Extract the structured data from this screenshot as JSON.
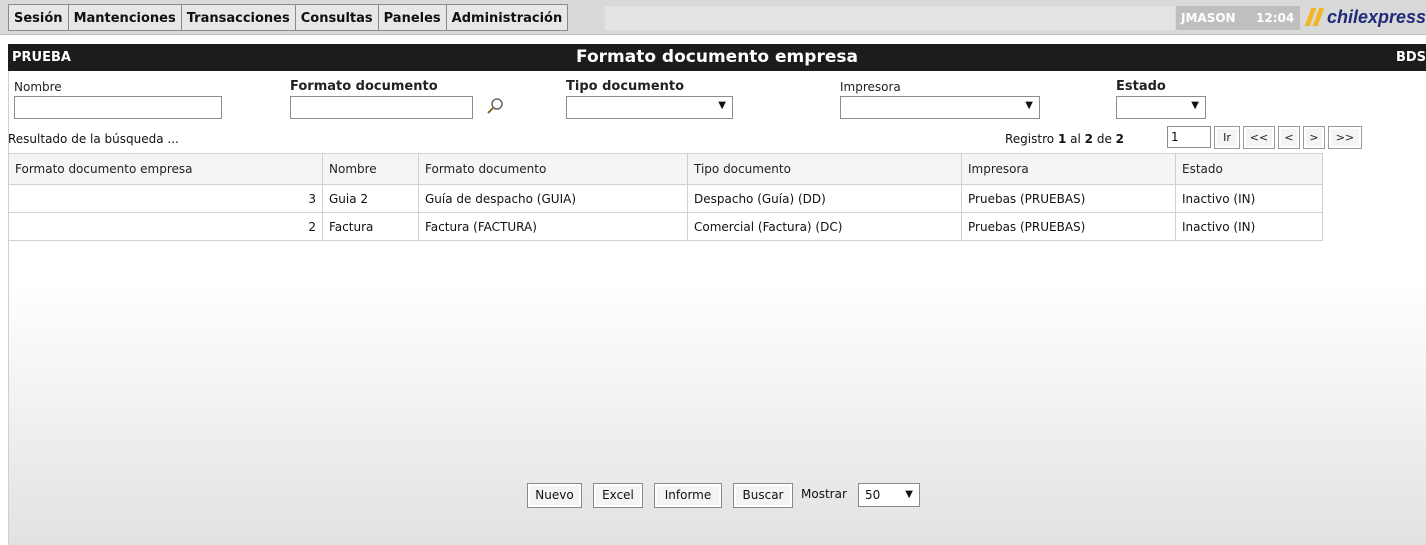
{
  "menu": {
    "items": [
      "Sesión",
      "Mantenciones",
      "Transacciones",
      "Consultas",
      "Paneles",
      "Administración"
    ],
    "user": "JMASON",
    "time": "12:04",
    "logo_text": "chilexpress"
  },
  "titlebar": {
    "left": "PRUEBA",
    "title": "Formato documento empresa",
    "right": "BDS"
  },
  "filters": {
    "nombre_label": "Nombre",
    "nombre_value": "",
    "formato_label": "Formato documento",
    "formato_value": "",
    "tipo_label": "Tipo documento",
    "tipo_value": "",
    "impresora_label": "Impresora",
    "impresora_value": "",
    "estado_label": "Estado",
    "estado_value": ""
  },
  "results": {
    "label": "Resultado de la búsqueda ...",
    "registro_prefix": "Registro",
    "registro_from": "1",
    "registro_sep": "al",
    "registro_to": "2",
    "registro_of": "de",
    "registro_total": "2",
    "page_value": "1",
    "go_label": "Ir",
    "first_label": "<<",
    "prev_label": "<",
    "next_label": ">",
    "last_label": ">>"
  },
  "table": {
    "columns": [
      "Formato documento empresa",
      "Nombre",
      "Formato documento",
      "Tipo documento",
      "Impresora",
      "Estado"
    ],
    "rows": [
      [
        "3",
        "Guia 2",
        "Guía de despacho (GUIA)",
        "Despacho (Guía) (DD)",
        "Pruebas (PRUEBAS)",
        "Inactivo (IN)"
      ],
      [
        "2",
        "Factura",
        "Factura (FACTURA)",
        "Comercial (Factura) (DC)",
        "Pruebas (PRUEBAS)",
        "Inactivo (IN)"
      ]
    ]
  },
  "actions": {
    "nuevo": "Nuevo",
    "excel": "Excel",
    "informe": "Informe",
    "buscar": "Buscar",
    "mostrar_label": "Mostrar",
    "mostrar_value": "50"
  },
  "icons": {
    "search": "magnifier-icon",
    "dropdown": "triangle-down-icon"
  },
  "colors": {
    "titlebar_bg": "#1c1c1c",
    "logo_yellow": "#f2b526",
    "logo_blue": "#1f2b78"
  }
}
